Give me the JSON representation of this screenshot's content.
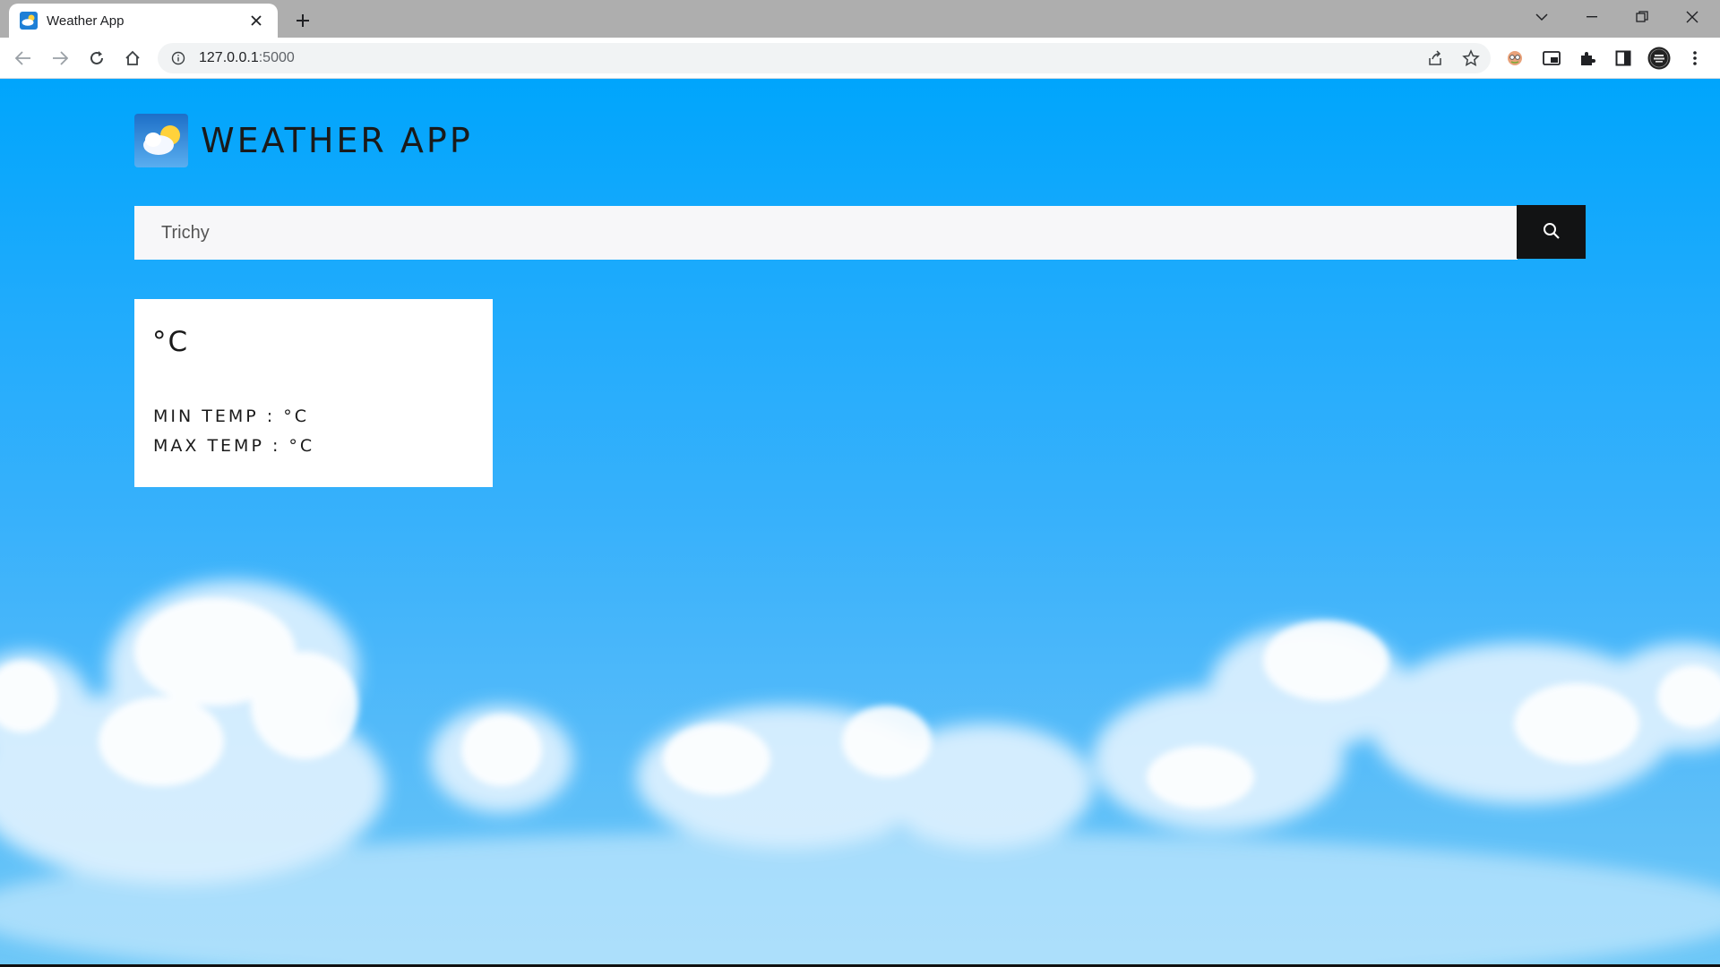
{
  "browser": {
    "tab_title": "Weather App",
    "url_host": "127.0.0.1",
    "url_port": ":5000",
    "icons": {
      "back": "arrow-left-icon",
      "forward": "arrow-right-icon",
      "reload": "reload-icon",
      "home": "home-icon",
      "site_info": "info-icon",
      "share": "share-icon",
      "bookmark": "star-icon",
      "extension_a": "extension-face-icon",
      "pip": "picture-in-picture-icon",
      "extensions": "puzzle-icon",
      "side_panel": "side-panel-icon",
      "profile": "avatar",
      "menu": "kebab-menu-icon"
    }
  },
  "app": {
    "title": "WEATHER APP",
    "search": {
      "value": "Trichy",
      "button_icon": "search-icon"
    },
    "card": {
      "temperature": "°C",
      "min_temp": "MIN TEMP : °C",
      "max_temp": "MAX TEMP : °C"
    }
  },
  "colors": {
    "sky_top": "#00a5fc",
    "sky_bottom": "#6ec7f7",
    "search_button": "#121314",
    "card": "#ffffff"
  }
}
